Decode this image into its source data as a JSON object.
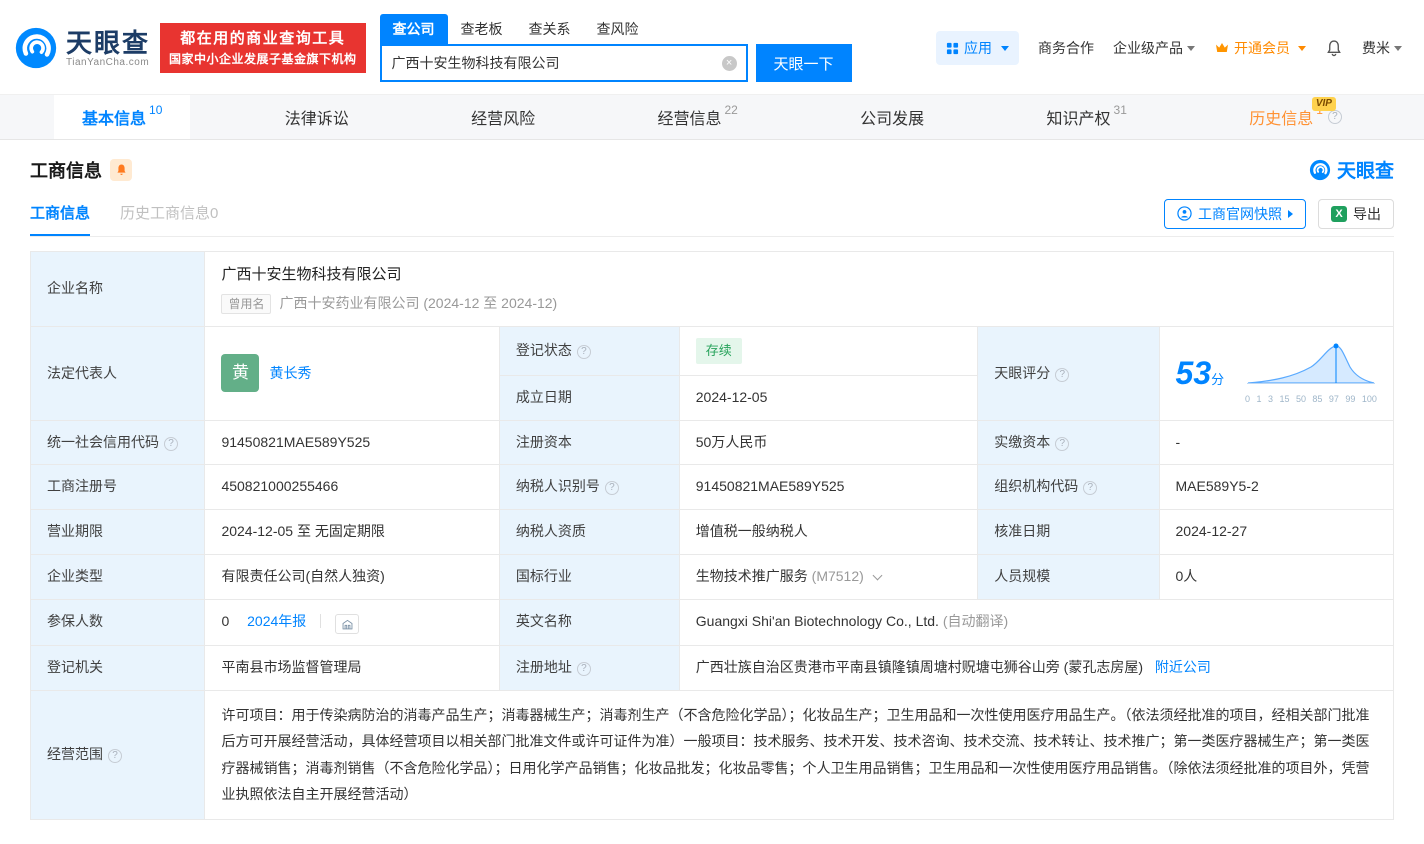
{
  "colors": {
    "brand_blue": "#0084ff",
    "banner_red": "#e83430",
    "vip_orange": "#ff8a00",
    "history_tab_orange": "#ff9234",
    "status_green": "#27a35b",
    "avatar_green": "#63af88",
    "label_cell_blue": "#e9f4fd",
    "excel_green": "#1fa05e"
  },
  "icons": {
    "clear": "×",
    "excel": "X"
  },
  "header": {
    "logo": {
      "cn": "天眼查",
      "en": "TianYanCha.com"
    },
    "slogan": {
      "line1": "都在用的商业查询工具",
      "line2": "国家中小企业发展子基金旗下机构"
    },
    "search_tabs": [
      {
        "label": "查公司"
      },
      {
        "label": "查老板"
      },
      {
        "label": "查关系"
      },
      {
        "label": "查风险"
      }
    ],
    "search": {
      "value": "广西十安生物科技有限公司",
      "button": "天眼一下"
    },
    "nav": {
      "app": "应用",
      "cooperation": "商务合作",
      "enterprise": "企业级产品",
      "vip": "开通会员",
      "user": "费米"
    }
  },
  "tabs": [
    {
      "label": "基本信息",
      "count": "10"
    },
    {
      "label": "法律诉讼",
      "count": ""
    },
    {
      "label": "经营风险",
      "count": ""
    },
    {
      "label": "经营信息",
      "count": "22"
    },
    {
      "label": "公司发展",
      "count": ""
    },
    {
      "label": "知识产权",
      "count": "31"
    },
    {
      "label": "历史信息",
      "count": "1",
      "badge": "VIP"
    }
  ],
  "section": {
    "title": "工商信息",
    "brand": "天眼查"
  },
  "subtabs": [
    {
      "label": "工商信息"
    },
    {
      "label": "历史工商信息0"
    }
  ],
  "actions": {
    "snapshot": "工商官网快照",
    "export": "导出"
  },
  "info": {
    "company_name": {
      "label": "企业名称",
      "value": "广西十安生物科技有限公司",
      "former_tag": "曾用名",
      "former": "广西十安药业有限公司 (2024-12 至 2024-12)"
    },
    "legal_rep": {
      "label": "法定代表人",
      "avatar": "黄",
      "name": "黄长秀"
    },
    "reg_status": {
      "label": "登记状态",
      "value": "存续"
    },
    "establish_date": {
      "label": "成立日期",
      "value": "2024-12-05"
    },
    "score": {
      "label": "天眼评分",
      "value": "53",
      "unit": "分",
      "ticks": [
        "0",
        "1",
        "3",
        "15",
        "50",
        "85",
        "97",
        "99",
        "100"
      ]
    },
    "credit_code": {
      "label": "统一社会信用代码",
      "value": "91450821MAE589Y525"
    },
    "reg_capital": {
      "label": "注册资本",
      "value": "50万人民币"
    },
    "paid_capital": {
      "label": "实缴资本",
      "value": "-"
    },
    "reg_no": {
      "label": "工商注册号",
      "value": "450821000255466"
    },
    "tax_id": {
      "label": "纳税人识别号",
      "value": "91450821MAE589Y525"
    },
    "org_code": {
      "label": "组织机构代码",
      "value": "MAE589Y5-2"
    },
    "term": {
      "label": "营业期限",
      "value": "2024-12-05 至 无固定期限"
    },
    "tax_quality": {
      "label": "纳税人资质",
      "value": "增值税一般纳税人"
    },
    "approve_date": {
      "label": "核准日期",
      "value": "2024-12-27"
    },
    "company_type": {
      "label": "企业类型",
      "value": "有限责任公司(自然人独资)"
    },
    "industry": {
      "label": "国标行业",
      "value": "生物技术推广服务",
      "code": "(M7512)"
    },
    "staff_size": {
      "label": "人员规模",
      "value": "0人"
    },
    "insured": {
      "label": "参保人数",
      "value": "0",
      "report": "2024年报"
    },
    "english_name": {
      "label": "英文名称",
      "value": "Guangxi Shi'an Biotechnology Co., Ltd.",
      "note": "(自动翻译)"
    },
    "authority": {
      "label": "登记机关",
      "value": "平南县市场监督管理局"
    },
    "address": {
      "label": "注册地址",
      "value": "广西壮族自治区贵港市平南县镇隆镇周塘村贶塘屯狮谷山旁 (蒙孔志房屋)",
      "link": "附近公司"
    },
    "scope": {
      "label": "经营范围",
      "value": "许可项目：用于传染病防治的消毒产品生产；消毒器械生产；消毒剂生产（不含危险化学品）；化妆品生产；卫生用品和一次性使用医疗用品生产。（依法须经批准的项目，经相关部门批准后方可开展经营活动，具体经营项目以相关部门批准文件或许可证件为准）一般项目：技术服务、技术开发、技术咨询、技术交流、技术转让、技术推广；第一类医疗器械生产；第一类医疗器械销售；消毒剂销售（不含危险化学品）；日用化学产品销售；化妆品批发；化妆品零售；个人卫生用品销售；卫生用品和一次性使用医疗用品销售。（除依法须经批准的项目外，凭营业执照依法自主开展经营活动）"
    }
  }
}
